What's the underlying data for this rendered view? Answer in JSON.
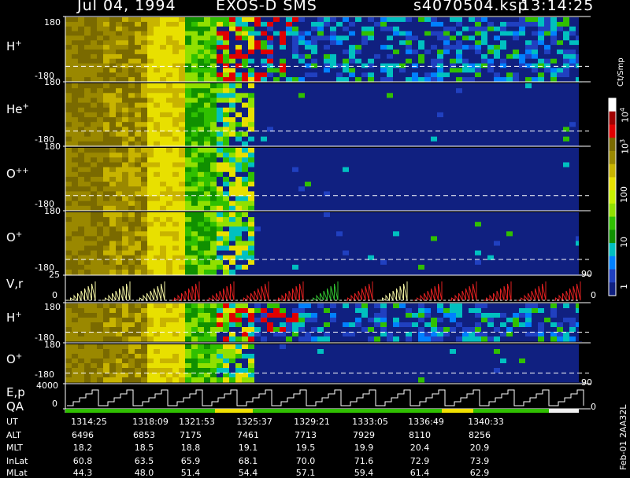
{
  "header": {
    "date": "Jul 04, 1994",
    "instrument": "EXOS-D SMS",
    "file": "s4070504.ksp",
    "time": "13:14:25"
  },
  "panels": [
    {
      "label": "H",
      "sup": "+",
      "ymax": "180",
      "ymin": "-180"
    },
    {
      "label": "He",
      "sup": "+",
      "ymax": "180",
      "ymin": "-180"
    },
    {
      "label": "O",
      "sup": "++",
      "ymax": "180",
      "ymin": "-180"
    },
    {
      "label": "O",
      "sup": "+",
      "ymax": "180",
      "ymin": "-180"
    },
    {
      "label": "V,r",
      "sup": "",
      "ymax": "25",
      "ymin": "0"
    },
    {
      "label": "H",
      "sup": "+",
      "ymax": "180",
      "ymin": "-180"
    },
    {
      "label": "O",
      "sup": "+",
      "ymax": "180",
      "ymin": "-180"
    },
    {
      "label": "E,p",
      "sup": "",
      "ymax": "4000",
      "ymin": "0"
    }
  ],
  "qa_label": "QA",
  "side_labels": {
    "vr_right_top": "90",
    "vr_right_zero": "0",
    "ep_right_top": "90",
    "ep_right_zero": "0"
  },
  "colorbar": {
    "unit": "Ct/Smp",
    "ticks": [
      "10^4",
      "10^3",
      "100",
      "10",
      "1"
    ],
    "colors": [
      "#ffffff",
      "#a00000",
      "#e00000",
      "#7a6a00",
      "#9a8800",
      "#c8b400",
      "#e8e000",
      "#c8f000",
      "#90e000",
      "#30c000",
      "#109000",
      "#00c0c0",
      "#0080ff",
      "#2040c0",
      "#102080"
    ]
  },
  "stamp": "Feb-01 2AA32L",
  "orbit": {
    "rows": [
      {
        "name": "UT",
        "values": [
          "1314:25",
          "1318:09",
          "1321:53",
          "1325:37",
          "1329:21",
          "1333:05",
          "1336:49",
          "1340:33"
        ]
      },
      {
        "name": "ALT",
        "values": [
          "6496",
          "6853",
          "7175",
          "7461",
          "7713",
          "7929",
          "8110",
          "8256"
        ]
      },
      {
        "name": "MLT",
        "values": [
          "18.2",
          "18.5",
          "18.8",
          "19.1",
          "19.5",
          "19.9",
          "20.4",
          "20.9"
        ]
      },
      {
        "name": "InLat",
        "values": [
          "60.8",
          "63.5",
          "65.9",
          "68.1",
          "70.0",
          "71.6",
          "72.9",
          "73.9"
        ]
      },
      {
        "name": "MLat",
        "values": [
          "44.3",
          "48.0",
          "51.4",
          "54.4",
          "57.1",
          "59.4",
          "61.4",
          "62.9"
        ]
      }
    ]
  },
  "chart_data": {
    "type": "heatmap",
    "title": "Jul 04, 1994   EXOS-D SMS",
    "x": [
      "1314:25",
      "1318:09",
      "1321:53",
      "1325:37",
      "1329:21",
      "1333:05",
      "1336:49",
      "1340:33"
    ],
    "panels": [
      "H+",
      "He+",
      "O++",
      "O+",
      "V,r",
      "H+",
      "O+",
      "E,p"
    ],
    "ylim_angle": [
      -180,
      180
    ],
    "ylim_vr": [
      0,
      25
    ],
    "ylim_ep": [
      0,
      4000
    ],
    "colorbar_unit": "Ct/Smp",
    "colorbar_ticks": [
      1,
      10,
      100,
      1000,
      10000
    ],
    "colorscale": "log"
  }
}
